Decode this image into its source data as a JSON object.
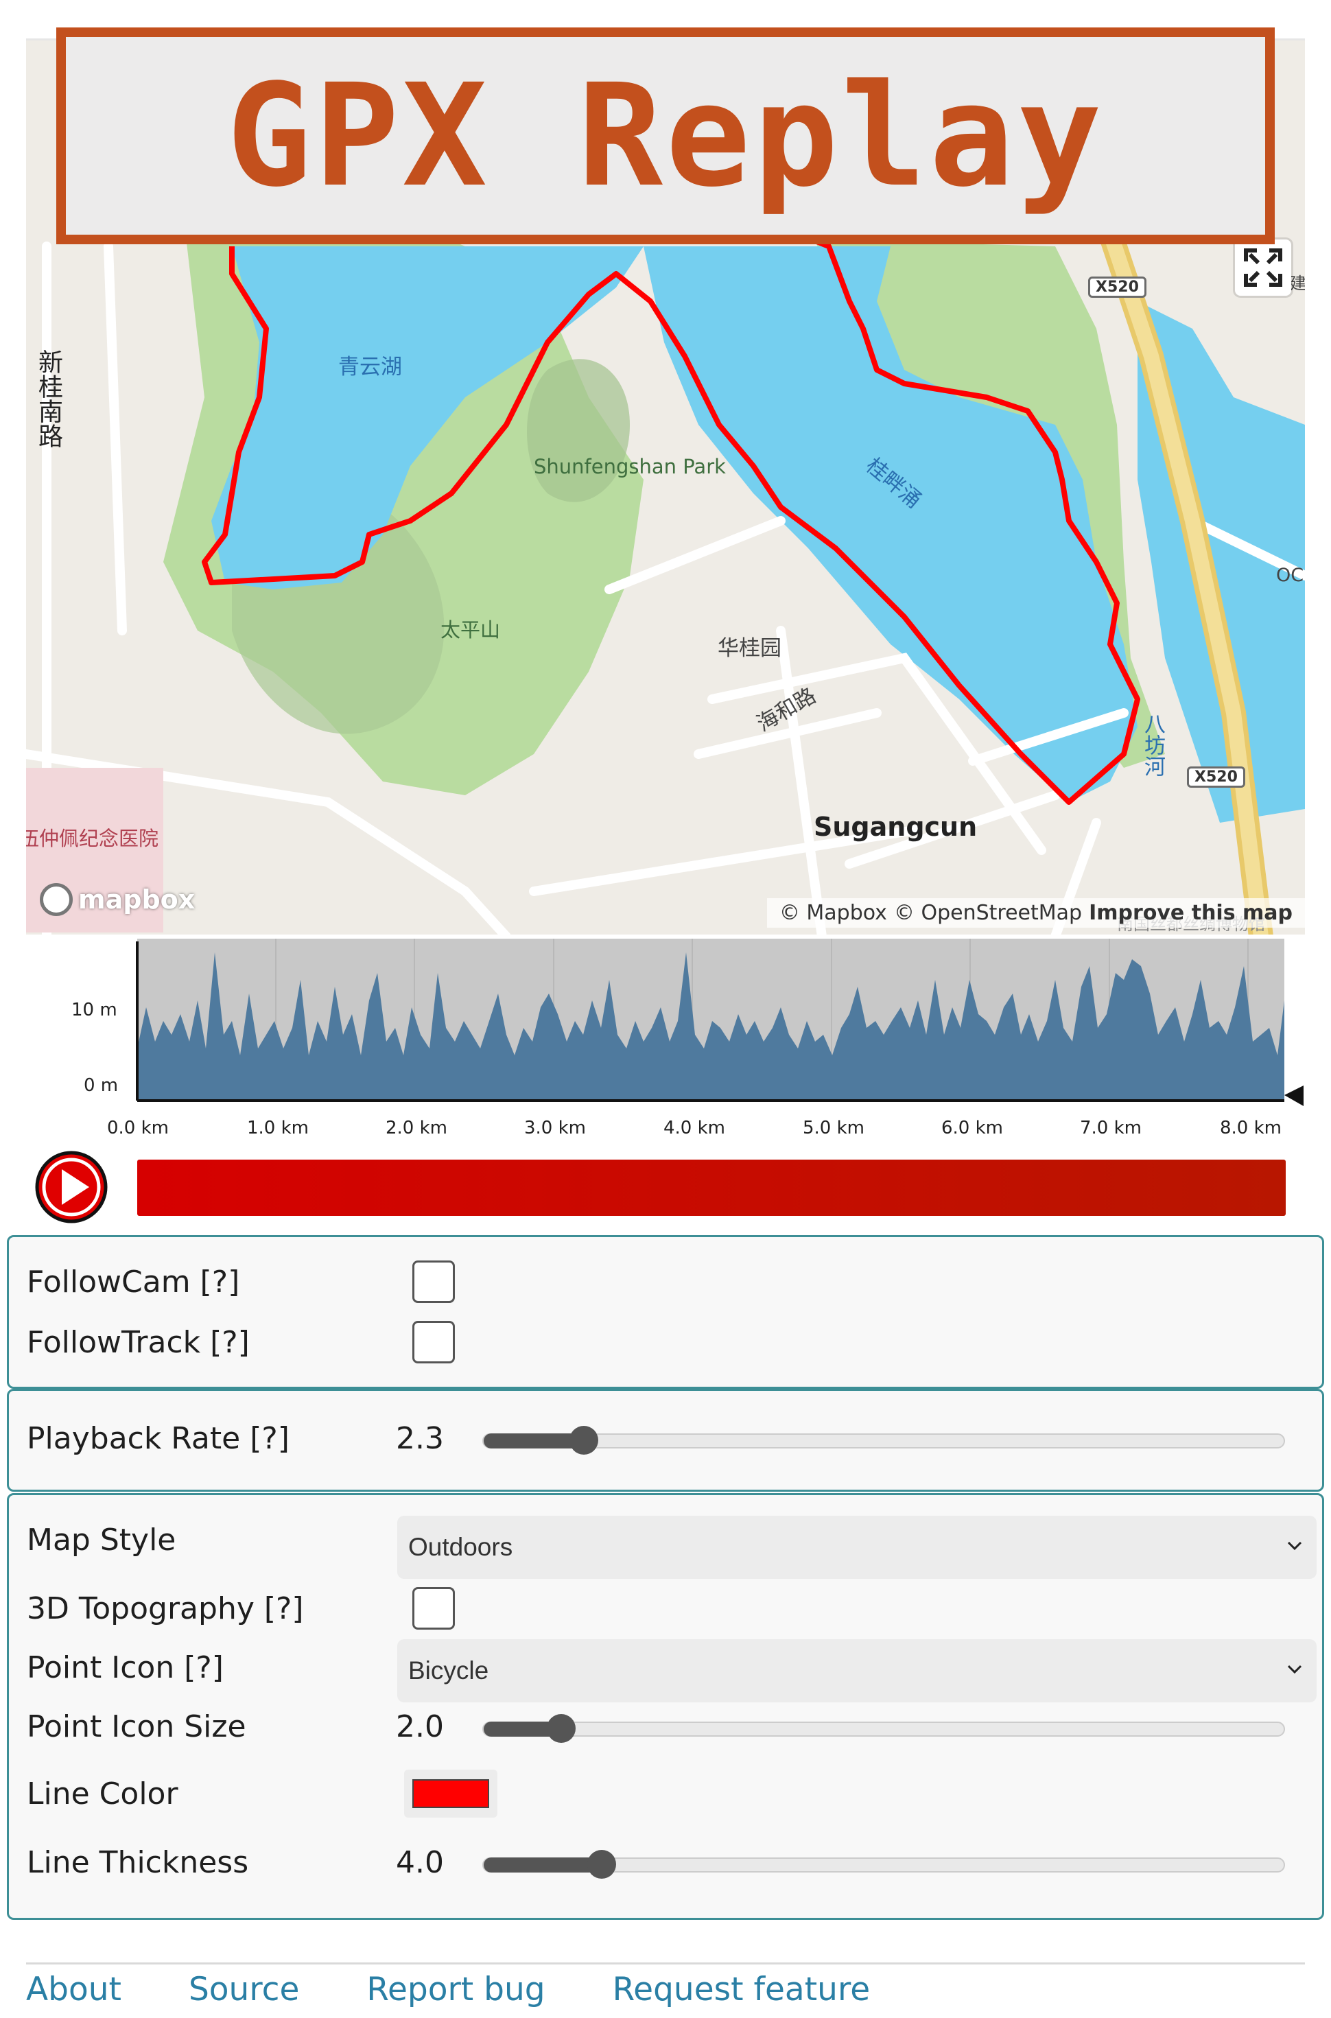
{
  "title": "GPX Replay",
  "map": {
    "labels": {
      "lake_qingyun": "青云湖",
      "park": "Shunfengshan Park",
      "taipingshan": "太平山",
      "huaguiyuan": "华桂园",
      "haihelu": "海和路",
      "sugangcun": "Sugangcun",
      "guijianyong": "桂畔涌",
      "bafanghe": "八坊河",
      "xinguinanlu": "新桂南路",
      "hospital": "伍仲佩纪念医院",
      "museum": "南国丝都丝绸博物馆",
      "oc": "OC",
      "jian": "建"
    },
    "shields": [
      "X520",
      "X520"
    ],
    "logo": "mapbox",
    "attribution": {
      "mapbox": "© Mapbox",
      "osm": "© OpenStreetMap",
      "improve": "Improve this map"
    },
    "track_color": "#ff0000"
  },
  "elevation": {
    "y_ticks": [
      "10 m",
      "0 m"
    ],
    "x_ticks": [
      "0.0 km",
      "1.0 km",
      "2.0 km",
      "3.0 km",
      "4.0 km",
      "5.0 km",
      "6.0 km",
      "7.0 km",
      "8.0 km"
    ],
    "fill_color": "#4f7a9e",
    "bg_color": "#c8c8c8"
  },
  "playback": {
    "progress": 1.0
  },
  "follow": {
    "followcam_label": "FollowCam [?]",
    "followcam_checked": false,
    "followtrack_label": "FollowTrack [?]",
    "followtrack_checked": false
  },
  "rate": {
    "label": "Playback Rate [?]",
    "value": "2.3",
    "fraction": 0.125
  },
  "style": {
    "map_style_label": "Map Style",
    "map_style_value": "Outdoors",
    "topo_label": "3D Topography [?]",
    "topo_checked": false,
    "icon_label": "Point Icon [?]",
    "icon_value": "Bicycle",
    "icon_size_label": "Point Icon Size",
    "icon_size_value": "2.0",
    "icon_size_fraction": 0.097,
    "line_color_label": "Line Color",
    "line_color": "#ff0000",
    "line_thickness_label": "Line Thickness",
    "line_thickness_value": "4.0",
    "line_thickness_fraction": 0.147
  },
  "footer": {
    "about": "About",
    "source": "Source",
    "report": "Report bug",
    "request": "Request feature"
  }
}
